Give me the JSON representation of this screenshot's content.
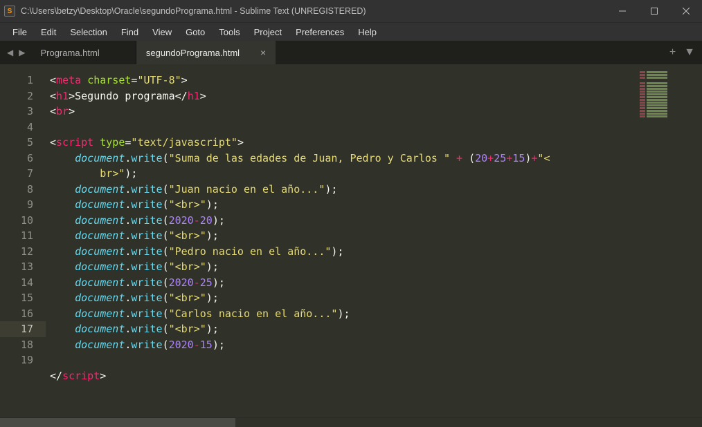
{
  "window": {
    "title": "C:\\Users\\betzy\\Desktop\\Oracle\\segundoPrograma.html - Sublime Text (UNREGISTERED)",
    "app_badge": "S"
  },
  "menu": {
    "items": [
      "File",
      "Edit",
      "Selection",
      "Find",
      "View",
      "Goto",
      "Tools",
      "Project",
      "Preferences",
      "Help"
    ]
  },
  "tabs": {
    "hist_back": "◀",
    "hist_fwd": "▶",
    "items": [
      {
        "label": "Programa.html",
        "active": false
      },
      {
        "label": "segundoPrograma.html",
        "active": true
      }
    ],
    "add": "+",
    "menu": "▼"
  },
  "editor": {
    "line_numbers": [
      "1",
      "2",
      "3",
      "4",
      "5",
      "6",
      "7",
      "8",
      "9",
      "10",
      "11",
      "12",
      "13",
      "14",
      "15",
      "16",
      "17",
      "18",
      "19"
    ],
    "current_line_index": 16,
    "code": {
      "l1": {
        "open": "<",
        "tag": "meta",
        "sp": " ",
        "attr": "charset",
        "eq": "=",
        "q": "\"",
        "val": "UTF-8",
        "close": ">"
      },
      "l2": {
        "open": "<",
        "tag": "h1",
        "close1": ">",
        "text": "Segundo programa",
        "open2": "</",
        "tag2": "h1",
        "close2": ">"
      },
      "l3": {
        "open": "<",
        "tag": "br",
        "close": ">"
      },
      "l5": {
        "open": "<",
        "tag": "script",
        "sp": " ",
        "attr": "type",
        "eq": "=",
        "q": "\"",
        "val": "text/javascript",
        "close": ">"
      },
      "l6": {
        "obj": "document",
        "dot": ".",
        "fn": "write",
        "lp": "(",
        "str": "\"Suma de las edades de Juan, Pedro y Carlos \"",
        "plus": " + ",
        "lp2": "(",
        "n1": "20",
        "p1": "+",
        "n2": "25",
        "p2": "+",
        "n3": "15",
        "rp2": ")",
        "plus2": "+",
        "str2": "\"<",
        "br_txt": "br",
        "str3": ">\"",
        "rp": ")",
        "sc": ";"
      },
      "l7": {
        "obj": "document",
        "dot": ".",
        "fn": "write",
        "lp": "(",
        "str": "\"Juan nacio en el año...\"",
        "rp": ")",
        "sc": ";"
      },
      "l8": {
        "obj": "document",
        "dot": ".",
        "fn": "write",
        "lp": "(",
        "str1": "\"<",
        "br": "br",
        "str2": ">\"",
        "rp": ")",
        "sc": ";"
      },
      "l9": {
        "obj": "document",
        "dot": ".",
        "fn": "write",
        "lp": "(",
        "n1": "2020",
        "op": "-",
        "n2": "20",
        "rp": ")",
        "sc": ";"
      },
      "l10": {
        "obj": "document",
        "dot": ".",
        "fn": "write",
        "lp": "(",
        "str1": "\"<",
        "br": "br",
        "str2": ">\"",
        "rp": ")",
        "sc": ";"
      },
      "l11": {
        "obj": "document",
        "dot": ".",
        "fn": "write",
        "lp": "(",
        "str": "\"Pedro nacio en el año...\"",
        "rp": ")",
        "sc": ";"
      },
      "l12": {
        "obj": "document",
        "dot": ".",
        "fn": "write",
        "lp": "(",
        "str1": "\"<",
        "br": "br",
        "str2": ">\"",
        "rp": ")",
        "sc": ";"
      },
      "l13": {
        "obj": "document",
        "dot": ".",
        "fn": "write",
        "lp": "(",
        "n1": "2020",
        "op": "-",
        "n2": "25",
        "rp": ")",
        "sc": ";"
      },
      "l14": {
        "obj": "document",
        "dot": ".",
        "fn": "write",
        "lp": "(",
        "str1": "\"<",
        "br": "br",
        "str2": ">\"",
        "rp": ")",
        "sc": ";"
      },
      "l15": {
        "obj": "document",
        "dot": ".",
        "fn": "write",
        "lp": "(",
        "str": "\"Carlos nacio en el año...\"",
        "rp": ")",
        "sc": ";"
      },
      "l16": {
        "obj": "document",
        "dot": ".",
        "fn": "write",
        "lp": "(",
        "str1": "\"<",
        "br": "br",
        "str2": ">\"",
        "rp": ")",
        "sc": ";"
      },
      "l17": {
        "obj": "document",
        "dot": ".",
        "fn": "write",
        "lp": "(",
        "n1": "2020",
        "op": "-",
        "n2": "15",
        "rp": ")",
        "sc": ";"
      },
      "l19": {
        "open": "</",
        "tag": "script",
        "close": ">"
      }
    }
  }
}
